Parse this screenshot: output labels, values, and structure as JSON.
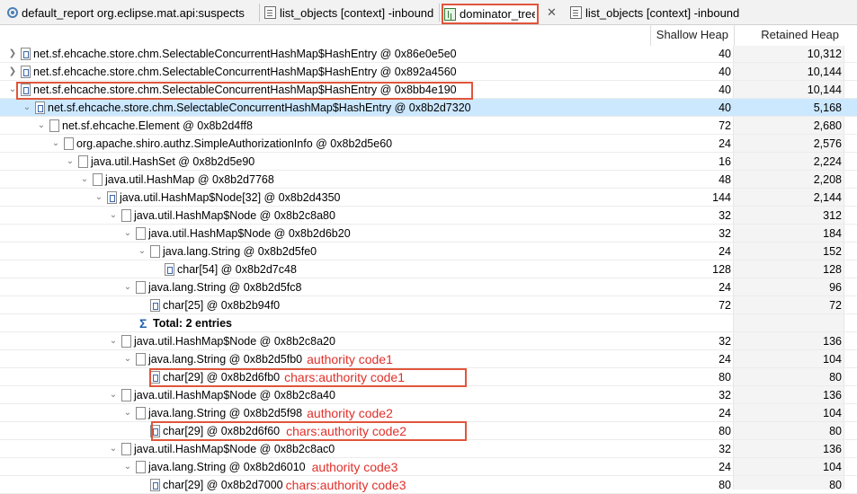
{
  "tabs": [
    {
      "label": "default_report  org.eclipse.mat.api:suspects"
    },
    {
      "label": "list_objects [context] -inbound"
    },
    {
      "label": "dominator_tree"
    },
    {
      "label": "list_objects [context] -inbound"
    }
  ],
  "columns": {
    "shallow": "Shallow Heap",
    "retained": "Retained Heap"
  },
  "rows": [
    {
      "text": "net.sf.ehcache.store.chm.SelectableConcurrentHashMap$HashEntry @ 0x86e0e5e0",
      "shallow": "40",
      "retained": "10,312"
    },
    {
      "text": "net.sf.ehcache.store.chm.SelectableConcurrentHashMap$HashEntry @ 0x892a4560",
      "shallow": "40",
      "retained": "10,144"
    },
    {
      "text": "net.sf.ehcache.store.chm.SelectableConcurrentHashMap$HashEntry @ 0x8bb4e190",
      "shallow": "40",
      "retained": "10,144"
    },
    {
      "text": "net.sf.ehcache.store.chm.SelectableConcurrentHashMap$HashEntry @ 0x8b2d7320",
      "shallow": "40",
      "retained": "5,168"
    },
    {
      "text": "net.sf.ehcache.Element @ 0x8b2d4ff8",
      "shallow": "72",
      "retained": "2,680"
    },
    {
      "text": "org.apache.shiro.authz.SimpleAuthorizationInfo @ 0x8b2d5e60",
      "shallow": "24",
      "retained": "2,576"
    },
    {
      "text": "java.util.HashSet @ 0x8b2d5e90",
      "shallow": "16",
      "retained": "2,224"
    },
    {
      "text": "java.util.HashMap @ 0x8b2d7768",
      "shallow": "48",
      "retained": "2,208"
    },
    {
      "text": "java.util.HashMap$Node[32] @ 0x8b2d4350",
      "shallow": "144",
      "retained": "2,144"
    },
    {
      "text": "java.util.HashMap$Node @ 0x8b2c8a80",
      "shallow": "32",
      "retained": "312"
    },
    {
      "text": "java.util.HashMap$Node @ 0x8b2d6b20",
      "shallow": "32",
      "retained": "184"
    },
    {
      "text": "java.lang.String @ 0x8b2d5fe0",
      "shallow": "24",
      "retained": "152"
    },
    {
      "text": "char[54] @ 0x8b2d7c48",
      "shallow": "128",
      "retained": "128"
    },
    {
      "text": "java.lang.String @ 0x8b2d5fc8",
      "shallow": "24",
      "retained": "96"
    },
    {
      "text": "char[25] @ 0x8b2b94f0",
      "shallow": "72",
      "retained": "72"
    },
    {
      "text": "Total: 2 entries",
      "shallow": "",
      "retained": ""
    },
    {
      "text": "java.util.HashMap$Node @ 0x8b2c8a20",
      "shallow": "32",
      "retained": "136"
    },
    {
      "text": "java.lang.String @ 0x8b2d5fb0",
      "shallow": "24",
      "retained": "104",
      "note": "authority code1"
    },
    {
      "text": "char[29] @ 0x8b2d6fb0",
      "shallow": "80",
      "retained": "80",
      "note": "chars:authority code1"
    },
    {
      "text": "java.util.HashMap$Node @ 0x8b2c8a40",
      "shallow": "32",
      "retained": "136"
    },
    {
      "text": "java.lang.String @ 0x8b2d5f98",
      "shallow": "24",
      "retained": "104",
      "note": "authority code2"
    },
    {
      "text": "char[29] @ 0x8b2d6f60",
      "shallow": "80",
      "retained": "80",
      "note": "chars:authority code2"
    },
    {
      "text": "java.util.HashMap$Node @ 0x8b2c8ac0",
      "shallow": "32",
      "retained": "136"
    },
    {
      "text": "java.lang.String @ 0x8b2d6010",
      "shallow": "24",
      "retained": "104",
      "note": "authority code3"
    },
    {
      "text": "char[29] @ 0x8b2d7000",
      "shallow": "80",
      "retained": "80",
      "note": "chars:authority code3"
    }
  ],
  "colors": {
    "highlight_box": "#e0553b",
    "annotation": "#e0302a",
    "selection": "#cce8ff"
  }
}
